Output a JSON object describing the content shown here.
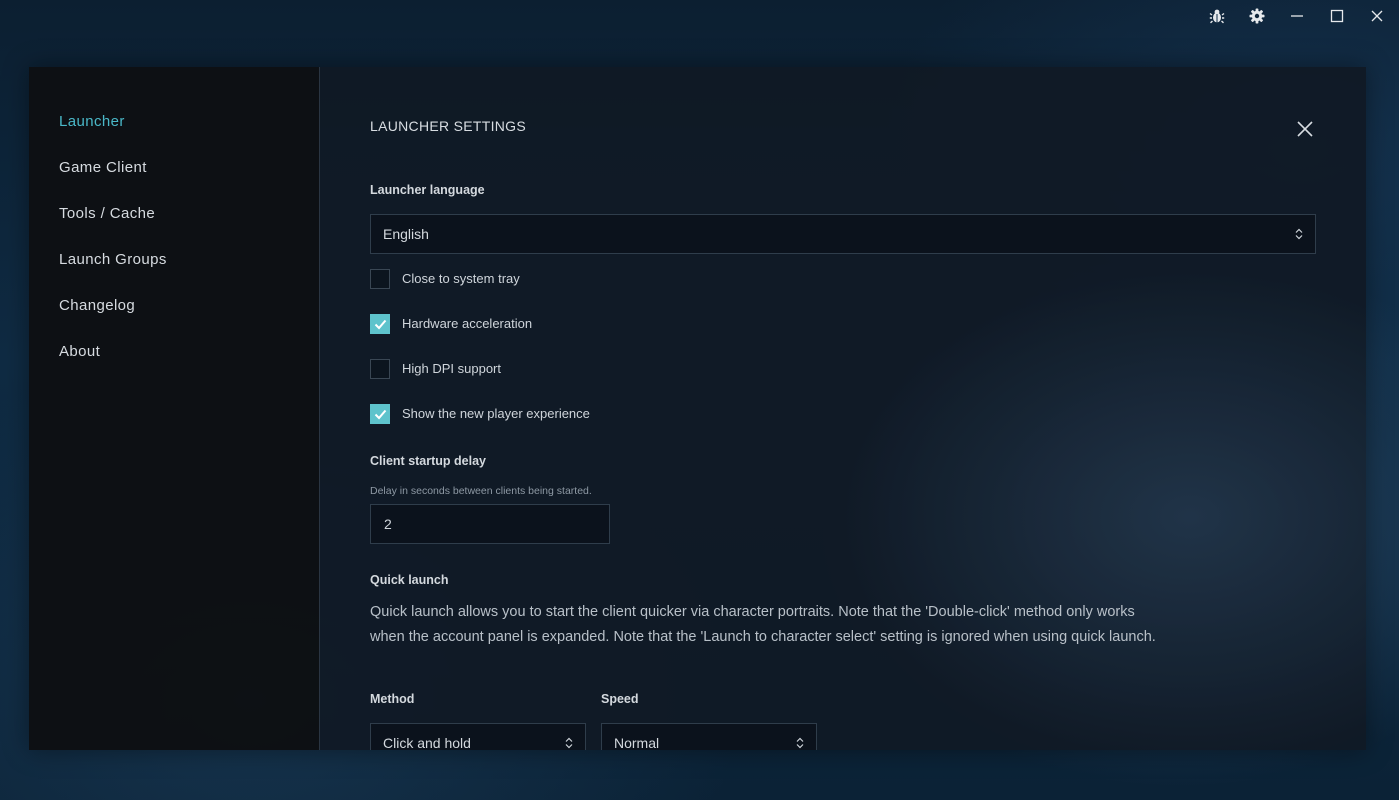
{
  "window": {
    "controls": {
      "bug_icon": "bug-icon",
      "settings_icon": "gear-icon",
      "minimize_icon": "minimize-icon",
      "maximize_icon": "maximize-icon",
      "close_icon": "close-icon"
    }
  },
  "sidebar": {
    "items": [
      {
        "label": "Launcher",
        "active": true
      },
      {
        "label": "Game Client",
        "active": false
      },
      {
        "label": "Tools / Cache",
        "active": false
      },
      {
        "label": "Launch Groups",
        "active": false
      },
      {
        "label": "Changelog",
        "active": false
      },
      {
        "label": "About",
        "active": false
      }
    ]
  },
  "settings": {
    "title": "LAUNCHER SETTINGS",
    "language": {
      "label": "Launcher language",
      "value": "English"
    },
    "checkboxes": [
      {
        "label": "Close to system tray",
        "checked": false
      },
      {
        "label": "Hardware acceleration",
        "checked": true
      },
      {
        "label": "High DPI support",
        "checked": false
      },
      {
        "label": "Show the new player experience",
        "checked": true
      }
    ],
    "startup_delay": {
      "label": "Client startup delay",
      "hint": "Delay in seconds between clients being started.",
      "value": "2"
    },
    "quick_launch": {
      "label": "Quick launch",
      "description": "Quick launch allows you to start the client quicker via character portraits. Note that the 'Double-click' method only works when the account panel is expanded. Note that the 'Launch to character select' setting is ignored when using quick launch.",
      "method": {
        "label": "Method",
        "value": "Click and hold"
      },
      "speed": {
        "label": "Speed",
        "value": "Normal"
      }
    }
  },
  "colors": {
    "accent": "#4ab8c8",
    "checkbox_checked": "#5ec3cc"
  }
}
